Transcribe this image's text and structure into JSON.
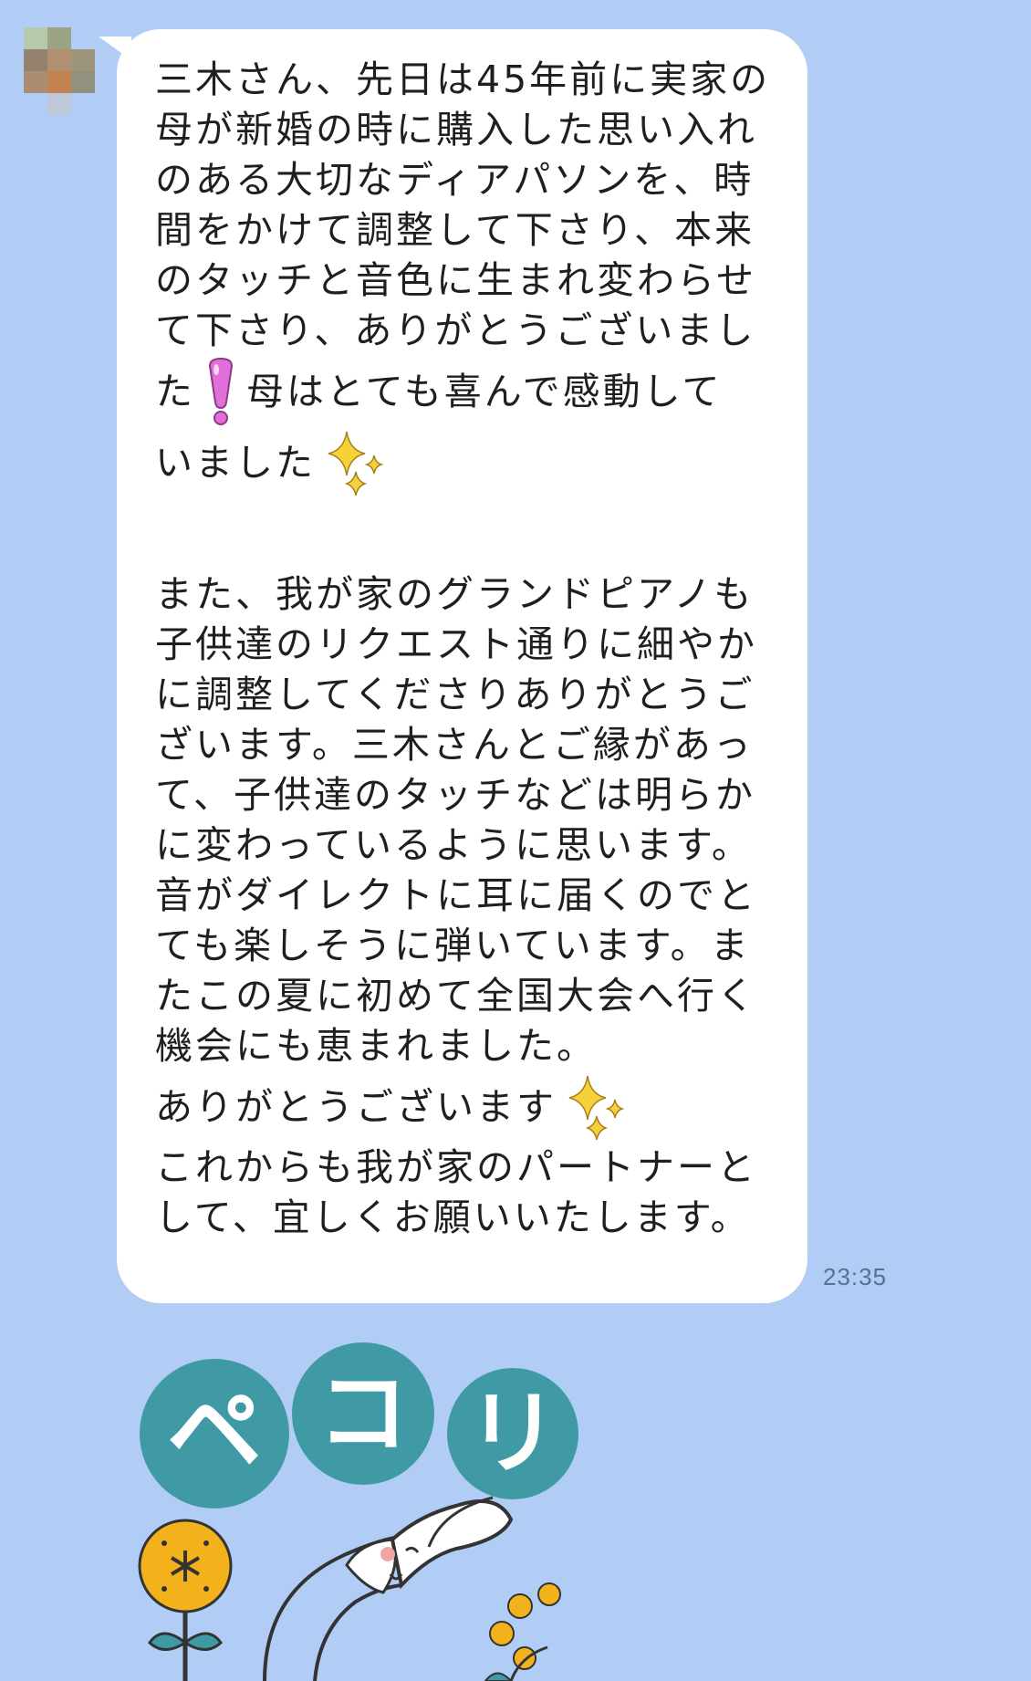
{
  "message": {
    "lines": [
      "三木さん、先日は45年前に実家の",
      "母が新婚の時に購入した思い入れ",
      "のある大切なディアパソンを、時",
      "間をかけて調整して下さり、本来",
      "のタッチと音色に生まれ変わらせ",
      "て下さり、ありがとうございまし"
    ],
    "line7_a": "た",
    "line7_b": "母はとても喜んで感動して",
    "line8": "いました",
    "para2": [
      "また、我が家のグランドピアノも",
      "子供達のリクエスト通りに細やか",
      "に調整してくださりありがとうご",
      "ざいます。三木さんとご縁があっ",
      "て、子供達のタッチなどは明らか",
      "に変わっているように思います。",
      "音がダイレクトに耳に届くのでと",
      "ても楽しそうに弾いています。ま",
      "たこの夏に初めて全国大会へ行く",
      "機会にも恵まれました。"
    ],
    "thanks": "ありがとうございます",
    "closing": [
      "これからも我が家のパートナーと",
      "して、宜しくお願いいたします。"
    ]
  },
  "timestamp": "23:35",
  "sticker": {
    "text": [
      "ペ",
      "コ",
      "リ"
    ],
    "icon": "bowing-rabbit-sticker"
  },
  "colors": {
    "background": "#b2cdf5",
    "bubble": "#ffffff",
    "sticker_circle": "#3f9aa6",
    "exclamation": "#e070d8",
    "sparkle": "#f5d23a"
  }
}
